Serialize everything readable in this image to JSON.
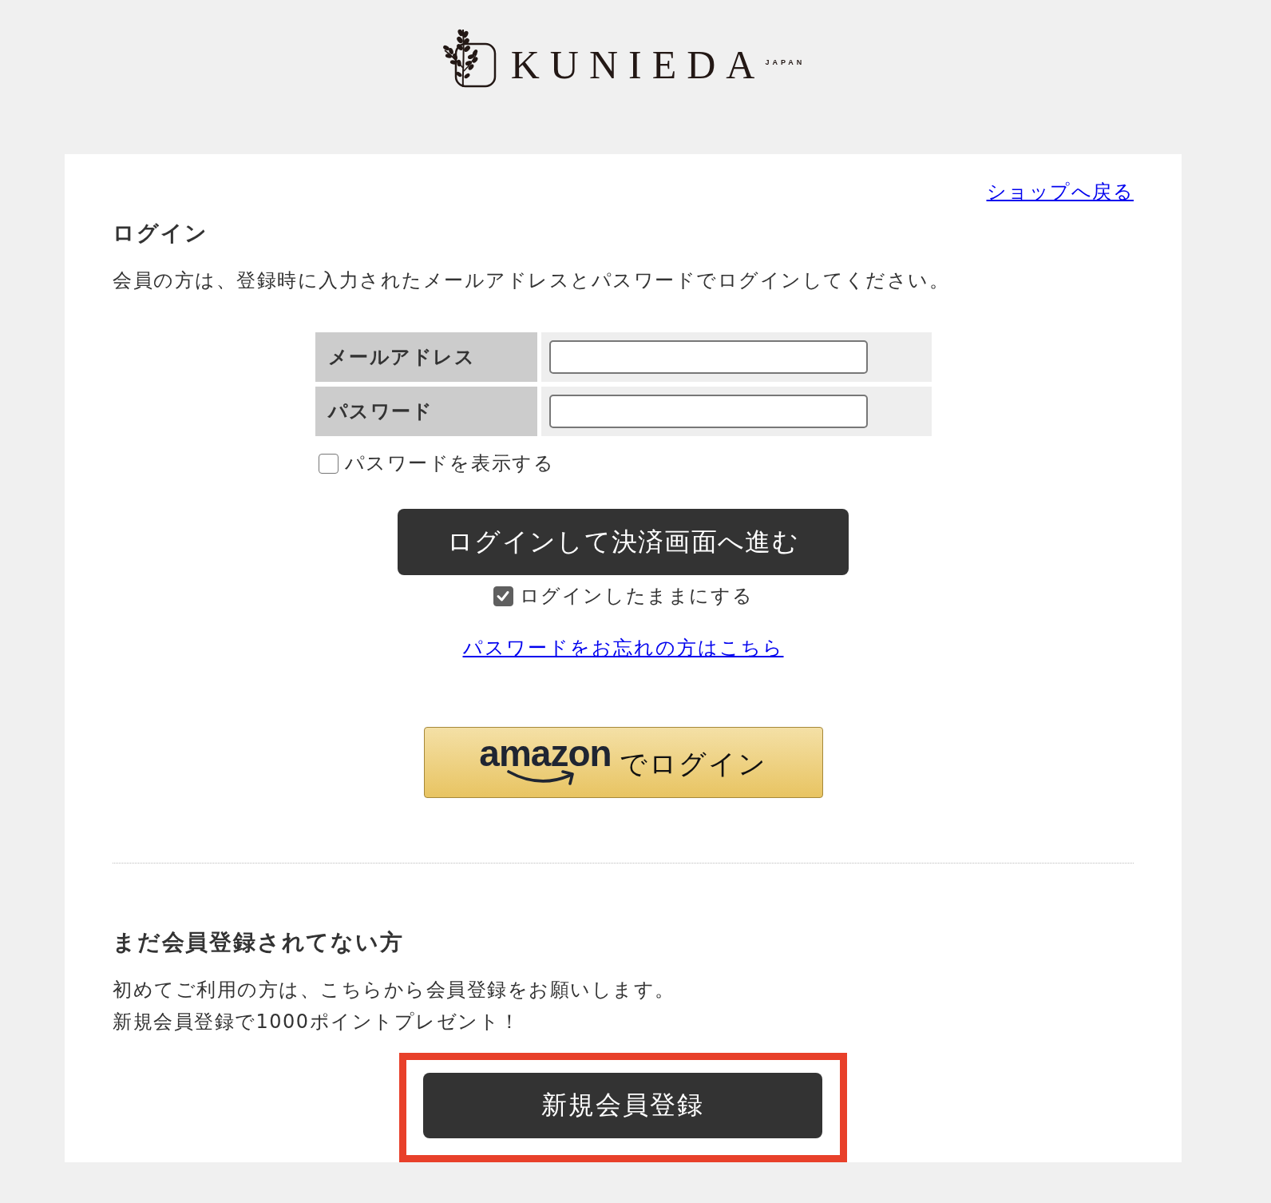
{
  "logo": {
    "name": "KUNIEDA",
    "tagline": "JAPAN"
  },
  "back_link": "ショップへ戻る",
  "login": {
    "title": "ログイン",
    "description": "会員の方は、登録時に入力されたメールアドレスとパスワードでログインしてください。",
    "fields": [
      {
        "label": "メールアドレス"
      },
      {
        "label": "パスワード"
      }
    ],
    "show_password": {
      "label": "パスワードを表示する",
      "checked": false
    },
    "submit_button": "ログインして決済画面へ進む",
    "stay_logged_in": {
      "label": "ログインしたままにする",
      "checked": true
    },
    "forgot_link": "パスワードをお忘れの方はこちら",
    "amazon_button": {
      "logo_text": "amazon",
      "label": "でログイン"
    }
  },
  "register": {
    "title": "まだ会員登録されてない方",
    "lines": [
      "初めてご利用の方は、こちらから会員登録をお願いします。",
      "新規会員登録で1000ポイントプレゼント！"
    ],
    "button": {
      "label": "新規会員登録",
      "highlighted": true
    }
  }
}
